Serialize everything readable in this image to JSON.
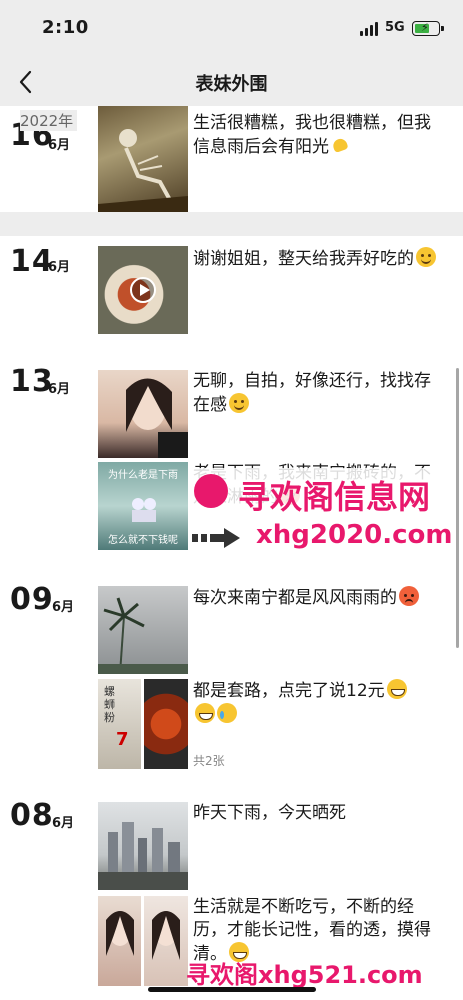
{
  "status_bar": {
    "time": "2:10",
    "network": "5G"
  },
  "nav": {
    "title": "表妹外围"
  },
  "year": "2022年",
  "posts": [
    {
      "day": "16",
      "month": "6月",
      "text": "生活很糟糕，我也很糟糕，但我信息雨后会有阳光",
      "emoji": "flexed-biceps"
    },
    {
      "day": "14",
      "month": "6月",
      "text": "谢谢姐姐，整天给我弄好吃的",
      "emoji": "smile"
    },
    {
      "day": "13",
      "month": "6月",
      "text": "无聊，自拍，好像还行，找找存在感",
      "emoji": "smile"
    },
    {
      "day": "",
      "month": "",
      "text": "老是下雨，我来南宁搬砖的，不是来淋雨的",
      "emoji": "angry",
      "image_caption_top": "为什么老是下雨",
      "image_caption_bottom": "怎么就不下钱呢"
    },
    {
      "day": "09",
      "month": "6月",
      "text": "每次来南宁都是风风雨雨的",
      "emoji": "angry"
    },
    {
      "day": "",
      "month": "",
      "text": "都是套路，点完了说12元",
      "emoji": "grin",
      "count": "共2张",
      "sign_text_a": "螺蛳粉",
      "sign_text_b": "7"
    },
    {
      "day": "08",
      "month": "6月",
      "text": "昨天下雨，今天晒死",
      "emoji": ""
    },
    {
      "day": "",
      "month": "",
      "text": "生活就是不断吃亏，不断的经历，才能长记性，看的透，摸得清。",
      "emoji": "grin"
    }
  ],
  "watermarks": {
    "brand": "寻欢阁信息网",
    "url_main": "xhg2020.com",
    "url_footer": "寻欢阁xhg521.com"
  },
  "colors": {
    "accent_pink": "#e8186c",
    "status_green": "#3cb043",
    "nav_bg": "#ededed"
  },
  "icons": [
    "back-chevron-icon",
    "signal-icon",
    "battery-icon",
    "play-icon",
    "arrow-icon"
  ]
}
